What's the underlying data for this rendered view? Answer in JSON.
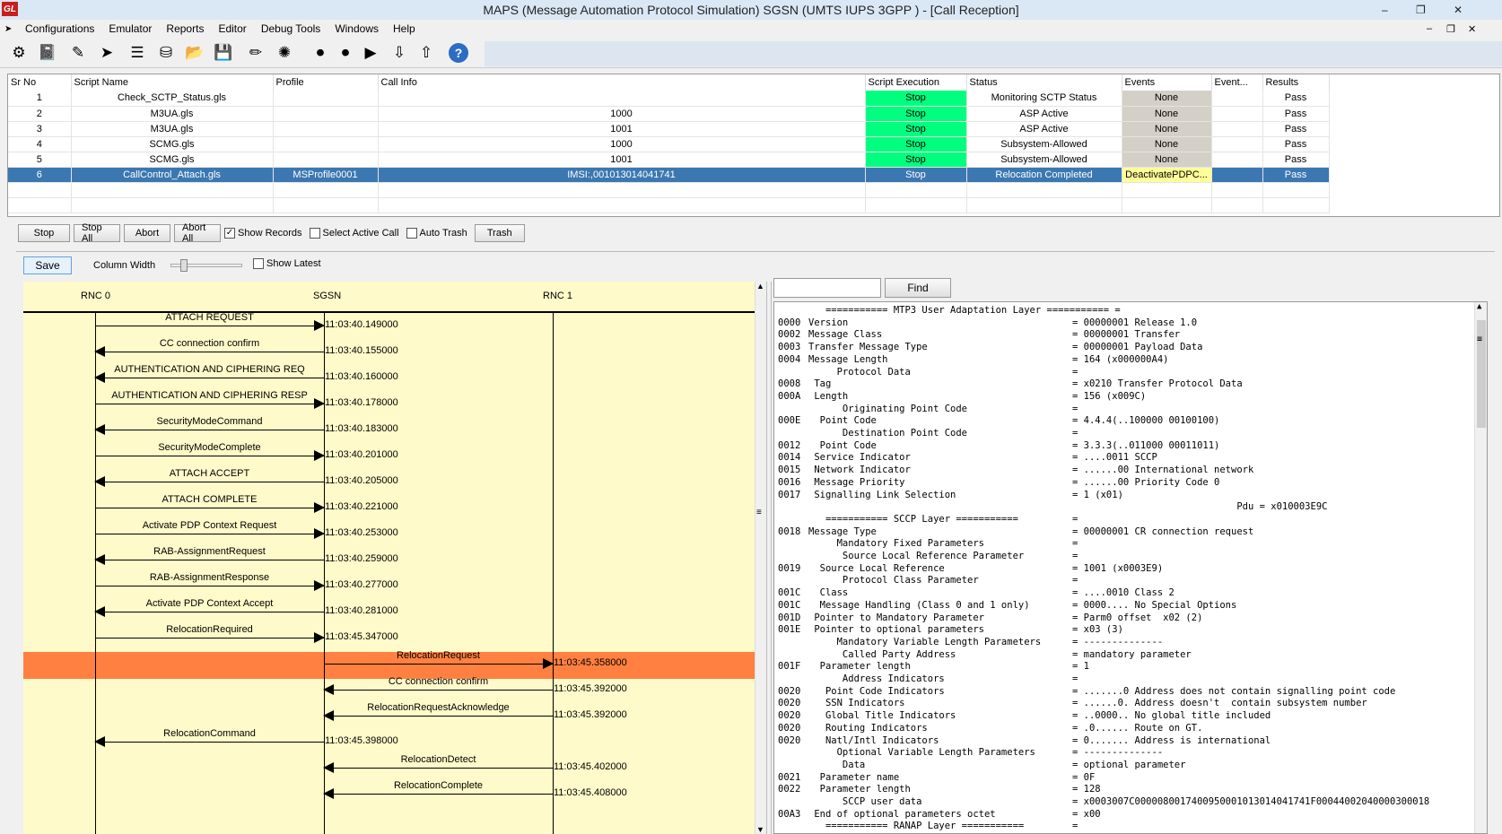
{
  "window": {
    "logo": "GL",
    "title": "MAPS (Message Automation Protocol Simulation) SGSN (UMTS IUPS 3GPP ) - [Call Reception]",
    "controls": [
      "–",
      "❐",
      "✕"
    ],
    "mdi_controls": [
      "–",
      "❐",
      "✕"
    ]
  },
  "menu": [
    {
      "label": "Configurations"
    },
    {
      "label": "Emulator"
    },
    {
      "label": "Reports"
    },
    {
      "label": "Editor"
    },
    {
      "label": "Debug Tools"
    },
    {
      "label": "Windows"
    },
    {
      "label": "Help"
    }
  ],
  "toolbar": {
    "icons": [
      {
        "name": "settings-icon",
        "glyph": "⚙"
      },
      {
        "name": "notebook-icon",
        "glyph": "📓"
      },
      {
        "name": "script-edit-icon",
        "glyph": "✎"
      },
      {
        "name": "start-icon",
        "glyph": "➤"
      },
      {
        "name": "profile-icon",
        "glyph": "☰"
      },
      {
        "name": "database-icon",
        "glyph": "⛁"
      },
      {
        "name": "folder-icon",
        "glyph": "📂"
      },
      {
        "name": "save-config-icon",
        "glyph": "💾"
      },
      {
        "name": "edit-icon",
        "glyph": "✏"
      },
      {
        "name": "network-icon",
        "glyph": "✺"
      },
      {
        "name": "stop-record-icon",
        "glyph": "⏺"
      },
      {
        "name": "record-icon",
        "glyph": "⏺"
      },
      {
        "name": "play-record-icon",
        "glyph": "▶"
      },
      {
        "name": "download-icon",
        "glyph": "⇩"
      },
      {
        "name": "upload-icon",
        "glyph": "⇧"
      },
      {
        "name": "help-icon",
        "glyph": "?"
      }
    ]
  },
  "grid": {
    "headers": [
      "Sr No",
      "Script Name",
      "Profile",
      "Call Info",
      "Script Execution",
      "Status",
      "Events",
      "Event...",
      "Results"
    ],
    "rows": [
      {
        "srno": "1",
        "script": "Check_SCTP_Status.gls",
        "profile": "",
        "callinfo": "",
        "exec": "Stop",
        "status": "Monitoring SCTP Status",
        "events": "None",
        "event2": "",
        "result": "Pass",
        "selected": false
      },
      {
        "srno": "2",
        "script": "M3UA.gls",
        "profile": "",
        "callinfo": "1000",
        "exec": "Stop",
        "status": "ASP Active",
        "events": "None",
        "event2": "",
        "result": "Pass",
        "selected": false
      },
      {
        "srno": "3",
        "script": "M3UA.gls",
        "profile": "",
        "callinfo": "1001",
        "exec": "Stop",
        "status": "ASP Active",
        "events": "None",
        "event2": "",
        "result": "Pass",
        "selected": false
      },
      {
        "srno": "4",
        "script": "SCMG.gls",
        "profile": "",
        "callinfo": "1000",
        "exec": "Stop",
        "status": "Subsystem-Allowed",
        "events": "None",
        "event2": "",
        "result": "Pass",
        "selected": false
      },
      {
        "srno": "5",
        "script": "SCMG.gls",
        "profile": "",
        "callinfo": "1001",
        "exec": "Stop",
        "status": "Subsystem-Allowed",
        "events": "None",
        "event2": "",
        "result": "Pass",
        "selected": false
      },
      {
        "srno": "6",
        "script": "CallControl_Attach.gls",
        "profile": "MSProfile0001",
        "callinfo": "IMSI:,001013014041741",
        "exec": "Stop",
        "status": "Relocation Completed",
        "events": "DeactivatePDPC...",
        "event2": "",
        "result": "Pass",
        "selected": true
      }
    ]
  },
  "controls": {
    "stop": "Stop",
    "stop_all": "Stop All",
    "abort": "Abort",
    "abort_all": "Abort All",
    "show_records": "Show Records",
    "show_records_checked": true,
    "select_active_call": "Select Active Call",
    "select_active_call_checked": false,
    "auto_trash": "Auto Trash",
    "auto_trash_checked": false,
    "trash": "Trash"
  },
  "ladder_controls": {
    "save": "Save",
    "column_width": "Column Width",
    "show_latest": "Show Latest",
    "show_latest_checked": false
  },
  "ladder": {
    "nodes": [
      "RNC 0",
      "SGSN",
      "RNC 1"
    ],
    "messages": [
      {
        "label": "ATTACH REQUEST",
        "from": 0,
        "to": 1,
        "time": "11:03:40.149000"
      },
      {
        "label": "CC connection confirm",
        "from": 1,
        "to": 0,
        "time": "11:03:40.155000"
      },
      {
        "label": "AUTHENTICATION AND CIPHERING REQ",
        "from": 1,
        "to": 0,
        "time": "11:03:40.160000"
      },
      {
        "label": "AUTHENTICATION AND CIPHERING RESP",
        "from": 0,
        "to": 1,
        "time": "11:03:40.178000"
      },
      {
        "label": "SecurityModeCommand",
        "from": 1,
        "to": 0,
        "time": "11:03:40.183000"
      },
      {
        "label": "SecurityModeComplete",
        "from": 0,
        "to": 1,
        "time": "11:03:40.201000"
      },
      {
        "label": "ATTACH ACCEPT",
        "from": 1,
        "to": 0,
        "time": "11:03:40.205000"
      },
      {
        "label": "ATTACH COMPLETE",
        "from": 0,
        "to": 1,
        "time": "11:03:40.221000"
      },
      {
        "label": "Activate PDP Context Request",
        "from": 0,
        "to": 1,
        "time": "11:03:40.253000"
      },
      {
        "label": "RAB-AssignmentRequest",
        "from": 1,
        "to": 0,
        "time": "11:03:40.259000"
      },
      {
        "label": "RAB-AssignmentResponse",
        "from": 0,
        "to": 1,
        "time": "11:03:40.277000"
      },
      {
        "label": "Activate PDP Context Accept",
        "from": 1,
        "to": 0,
        "time": "11:03:40.281000"
      },
      {
        "label": "RelocationRequired",
        "from": 0,
        "to": 1,
        "time": "11:03:45.347000"
      },
      {
        "label": "RelocationRequest",
        "from": 1,
        "to": 2,
        "time": "11:03:45.358000",
        "highlight": true
      },
      {
        "label": "CC connection confirm",
        "from": 2,
        "to": 1,
        "time": "11:03:45.392000"
      },
      {
        "label": "RelocationRequestAcknowledge",
        "from": 2,
        "to": 1,
        "time": "11:03:45.392000"
      },
      {
        "label": "RelocationCommand",
        "from": 1,
        "to": 0,
        "time": "11:03:45.398000"
      },
      {
        "label": "RelocationDetect",
        "from": 2,
        "to": 1,
        "time": "11:03:45.402000"
      },
      {
        "label": "RelocationComplete",
        "from": 2,
        "to": 1,
        "time": "11:03:45.408000"
      }
    ]
  },
  "find": {
    "label": "Find",
    "value": ""
  },
  "decode": [
    {
      "off": "",
      "field": "   =========== MTP3 User Adaptation Layer =========== =",
      "value": ""
    },
    {
      "off": "0000",
      "field": "Version",
      "value": "= 00000001 Release 1.0"
    },
    {
      "off": "0002",
      "field": "Message Class",
      "value": "= 00000001 Transfer"
    },
    {
      "off": "0003",
      "field": "Transfer Message Type",
      "value": "= 00000001 Payload Data"
    },
    {
      "off": "0004",
      "field": "Message Length",
      "value": "= 164 (x000000A4)"
    },
    {
      "off": "",
      "field": "     Protocol Data",
      "value": "="
    },
    {
      "off": "0008",
      "field": " Tag",
      "value": "= x0210 Transfer Protocol Data"
    },
    {
      "off": "000A",
      "field": " Length",
      "value": "= 156 (x009C)"
    },
    {
      "off": "",
      "field": "      Originating Point Code",
      "value": "="
    },
    {
      "off": "000E",
      "field": "  Point Code",
      "value": "= 4.4.4(..100000 00100100)"
    },
    {
      "off": "",
      "field": "      Destination Point Code",
      "value": "="
    },
    {
      "off": "0012",
      "field": "  Point Code",
      "value": "= 3.3.3(..011000 00011011)"
    },
    {
      "off": "0014",
      "field": " Service Indicator",
      "value": "= ....0011 SCCP"
    },
    {
      "off": "0015",
      "field": " Network Indicator",
      "value": "= ......00 International network"
    },
    {
      "off": "0016",
      "field": " Message Priority",
      "value": "= ......00 Priority Code 0"
    },
    {
      "off": "0017",
      "field": " Signalling Link Selection",
      "value": "= 1 (x01)"
    },
    {
      "off": "",
      "field": "",
      "value": "                             Pdu = x010003E9C"
    },
    {
      "off": "",
      "field": "   =========== SCCP Layer ===========",
      "value": "="
    },
    {
      "off": "0018",
      "field": "Message Type",
      "value": "= 00000001 CR connection request"
    },
    {
      "off": "",
      "field": "     Mandatory Fixed Parameters",
      "value": "="
    },
    {
      "off": "",
      "field": "      Source Local Reference Parameter",
      "value": "="
    },
    {
      "off": "0019",
      "field": "  Source Local Reference",
      "value": "= 1001 (x0003E9)"
    },
    {
      "off": "",
      "field": "      Protocol Class Parameter",
      "value": "="
    },
    {
      "off": "001C",
      "field": "  Class",
      "value": "= ....0010 Class 2"
    },
    {
      "off": "001C",
      "field": "  Message Handling (Class 0 and 1 only)",
      "value": "= 0000.... No Special Options"
    },
    {
      "off": "001D",
      "field": " Pointer to Mandatory Parameter",
      "value": "= Parm0 offset  x02 (2)"
    },
    {
      "off": "001E",
      "field": " Pointer to optional parameters",
      "value": "= x03 (3)"
    },
    {
      "off": "",
      "field": "     Mandatory Variable Length Parameters",
      "value": "= --------------"
    },
    {
      "off": "",
      "field": "      Called Party Address",
      "value": "= mandatory parameter"
    },
    {
      "off": "001F",
      "field": "  Parameter length",
      "value": "= 1"
    },
    {
      "off": "",
      "field": "      Address Indicators",
      "value": "="
    },
    {
      "off": "0020",
      "field": "   Point Code Indicators",
      "value": "= .......0 Address does not contain signalling point code"
    },
    {
      "off": "0020",
      "field": "   SSN Indicators",
      "value": "= ......0. Address doesn't  contain subsystem number"
    },
    {
      "off": "0020",
      "field": "   Global Title Indicators",
      "value": "= ..0000.. No global title included"
    },
    {
      "off": "0020",
      "field": "   Routing Indicators",
      "value": "= .0...... Route on GT."
    },
    {
      "off": "0020",
      "field": "   Natl/Intl Indicators",
      "value": "= 0....... Address is international"
    },
    {
      "off": "",
      "field": "     Optional Variable Length Parameters",
      "value": "= --------------"
    },
    {
      "off": "",
      "field": "      Data",
      "value": "= optional parameter"
    },
    {
      "off": "0021",
      "field": "  Parameter name",
      "value": "= 0F"
    },
    {
      "off": "0022",
      "field": "  Parameter length",
      "value": "= 128"
    },
    {
      "off": "",
      "field": "      SCCP user data",
      "value": "= x0003007C0000080017400950001013014041741F00044002040000300018"
    },
    {
      "off": "00A3",
      "field": " End of optional parameters octet",
      "value": "= x00"
    },
    {
      "off": "",
      "field": "   =========== RANAP Layer ===========",
      "value": "="
    }
  ]
}
